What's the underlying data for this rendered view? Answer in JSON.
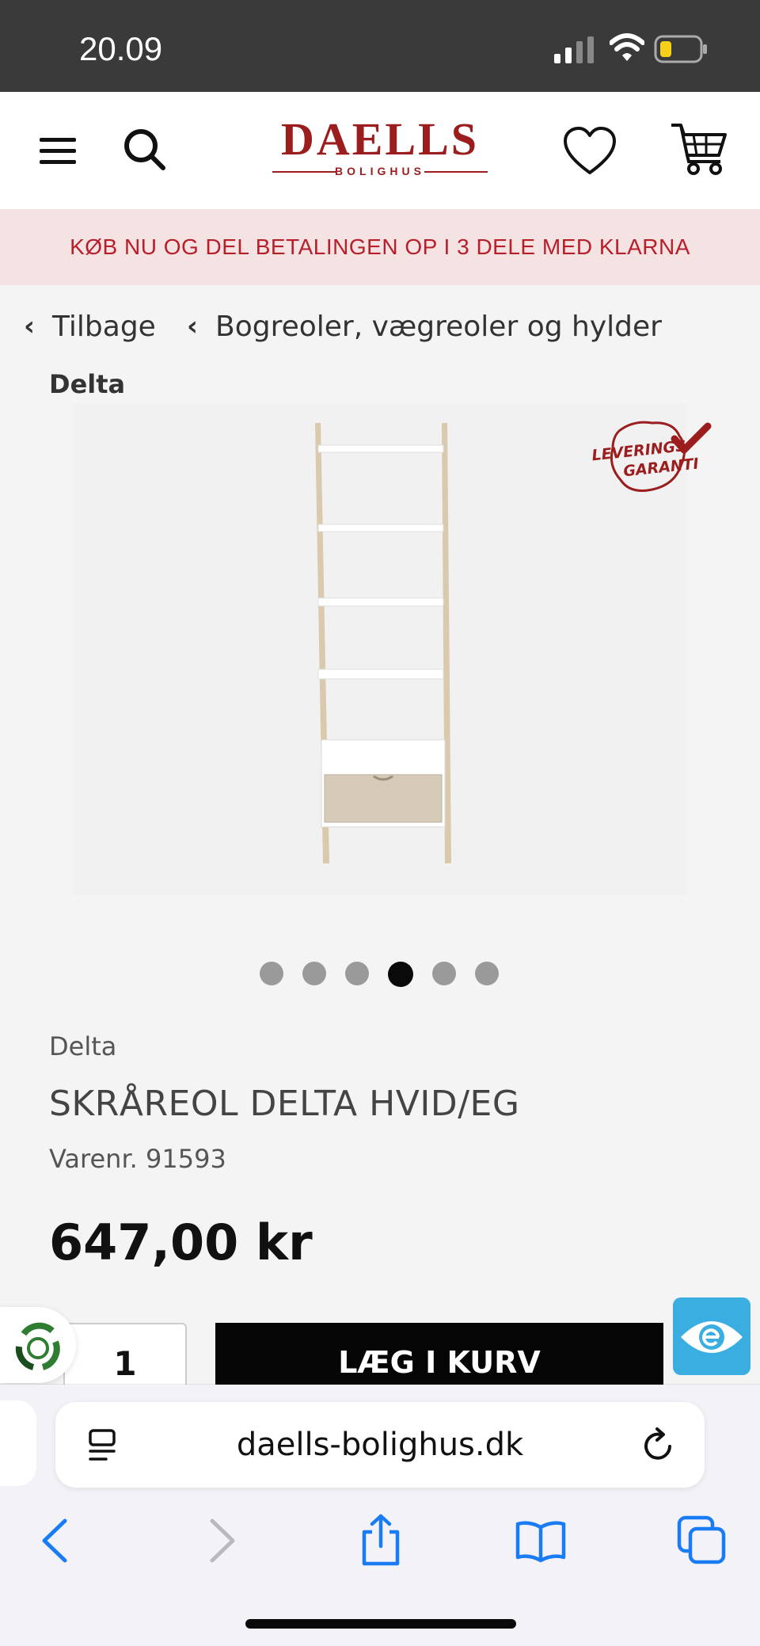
{
  "status_bar": {
    "time": "20.09",
    "icons": [
      "cellular-signal-icon",
      "wifi-icon",
      "battery-icon"
    ]
  },
  "header": {
    "menu_icon": "hamburger-menu-icon",
    "search_icon": "search-icon",
    "logo": {
      "name": "DAELLS",
      "subtitle": "BOLIGHUS"
    },
    "wishlist_icon": "heart-icon",
    "cart_icon": "shopping-cart-icon"
  },
  "promo": {
    "text": "KØB NU OG DEL BETALINGEN OP I 3 DELE MED KLARNA"
  },
  "breadcrumbs": {
    "back": "Tilbage",
    "category": "Bogreoler, vægreoler og hylder"
  },
  "brand_heading": "Delta",
  "badge": {
    "line1": "LEVERINGS",
    "line2": "GARANTI"
  },
  "carousel": {
    "total": 6,
    "active_index": 3
  },
  "product": {
    "brand": "Delta",
    "title": "SKRÅREOL DELTA HVID/EG",
    "sku": "Varenr. 91593",
    "price": "647,00 kr",
    "quantity": "1",
    "add_to_cart": "LÆG I KURV"
  },
  "browser": {
    "url": "daells-bolighus.dk",
    "nav_icons": [
      "back-arrow-icon",
      "forward-arrow-icon",
      "share-icon",
      "bookmarks-icon",
      "tabs-icon"
    ]
  },
  "colors": {
    "brand_red": "#9b1d1d",
    "promo_bg": "#f5e3e3",
    "promo_text": "#b71f2b",
    "ios_blue": "#1a7cf5",
    "a11y_blue": "#3aaee0"
  }
}
